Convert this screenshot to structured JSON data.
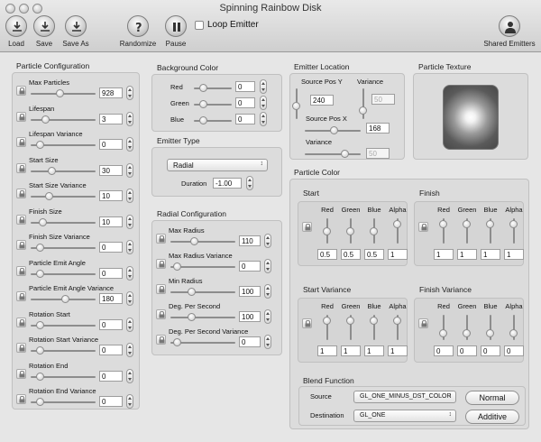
{
  "window": {
    "title": "Spinning Rainbow Disk"
  },
  "toolbar": {
    "load": "Load",
    "save": "Save",
    "save_as": "Save As",
    "randomize": "Randomize",
    "pause": "Pause",
    "loop_emitter": "Loop Emitter",
    "shared_emitters": "Shared Emitters"
  },
  "particle_config": {
    "title": "Particle Configuration",
    "rows": [
      {
        "label": "Max Particles",
        "value": "928"
      },
      {
        "label": "Lifespan",
        "value": "3"
      },
      {
        "label": "Lifespan Variance",
        "value": "0"
      },
      {
        "label": "Start Size",
        "value": "30"
      },
      {
        "label": "Start Size Variance",
        "value": "10"
      },
      {
        "label": "Finish Size",
        "value": "10"
      },
      {
        "label": "Finish Size Variance",
        "value": "0"
      },
      {
        "label": "Particle Emit Angle",
        "value": "0"
      },
      {
        "label": "Particle Emit Angle Variance",
        "value": "180"
      },
      {
        "label": "Rotation Start",
        "value": "0"
      },
      {
        "label": "Rotation Start Variance",
        "value": "0"
      },
      {
        "label": "Rotation End",
        "value": "0"
      },
      {
        "label": "Rotation End Variance",
        "value": "0"
      }
    ]
  },
  "background_color": {
    "title": "Background Color",
    "red": "Red",
    "green": "Green",
    "blue": "Blue",
    "red_value": "0",
    "green_value": "0",
    "blue_value": "0"
  },
  "emitter_type": {
    "title": "Emitter Type",
    "selected": "Radial",
    "duration_label": "Duration",
    "duration_value": "-1.00"
  },
  "radial_config": {
    "title": "Radial Configuration",
    "rows": [
      {
        "label": "Max Radius",
        "value": "110"
      },
      {
        "label": "Max Radius Variance",
        "value": "0"
      },
      {
        "label": "Min Radius",
        "value": "100"
      },
      {
        "label": "Deg. Per Second",
        "value": "100"
      },
      {
        "label": "Deg. Per Second Variance",
        "value": "0"
      }
    ]
  },
  "emitter_location": {
    "title": "Emitter Location",
    "pos_y_label": "Source Pos Y",
    "pos_y_value": "240",
    "variance_label": "Variance",
    "variance_y_value": "50",
    "pos_x_label": "Source Pos X",
    "pos_x_value": "168",
    "variance_x_value": "50"
  },
  "particle_texture": {
    "title": "Particle Texture"
  },
  "particle_color": {
    "title": "Particle Color",
    "channels": [
      "Red",
      "Green",
      "Blue",
      "Alpha"
    ],
    "start": {
      "title": "Start",
      "values": [
        "0.5",
        "0.5",
        "0.5",
        "1"
      ]
    },
    "finish": {
      "title": "Finish",
      "values": [
        "1",
        "1",
        "1",
        "1"
      ]
    },
    "start_variance": {
      "title": "Start Variance",
      "values": [
        "1",
        "1",
        "1",
        "1"
      ]
    },
    "finish_variance": {
      "title": "Finish Variance",
      "values": [
        "0",
        "0",
        "0",
        "0"
      ]
    }
  },
  "blend": {
    "title": "Blend Function",
    "source_label": "Source",
    "source_value": "GL_ONE_MINUS_DST_COLOR",
    "destination_label": "Destination",
    "destination_value": "GL_ONE",
    "normal_button": "Normal",
    "additive_button": "Additive"
  },
  "colors": {
    "panel": "#dcdcdc",
    "window": "#e6e6e6"
  }
}
